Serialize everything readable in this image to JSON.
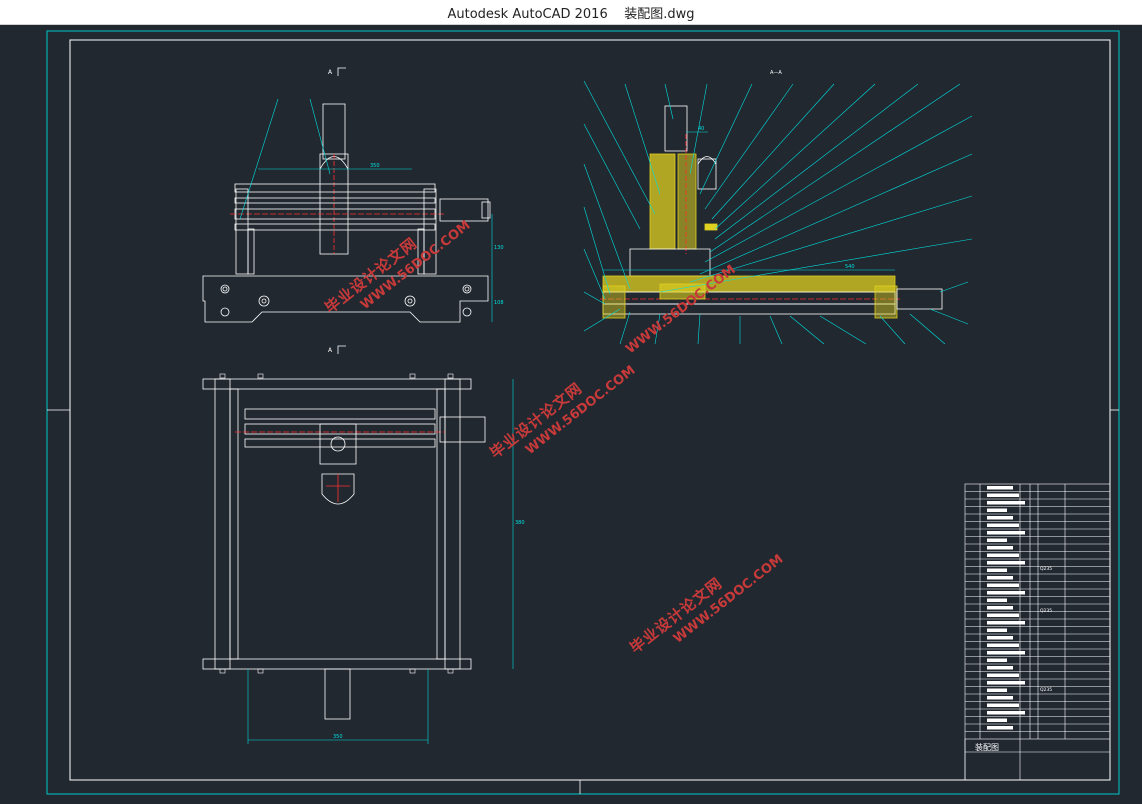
{
  "window": {
    "title": "Autodesk AutoCAD 2016    装配图.dwg"
  },
  "drawing": {
    "title_block_name": "装配图",
    "view_labels": {
      "top_view": "A",
      "section_view": "A—A"
    },
    "dimensions": {
      "top_width": "350",
      "front_width": "350",
      "front_height": "130",
      "front_height_2": "108",
      "section_width": "540",
      "section_small": "40",
      "plan_height": "380"
    },
    "materials": [
      "45钢",
      "Q235",
      "Q235",
      "Q235",
      "45钢"
    ]
  },
  "watermarks": [
    {
      "brand": "WWW.56DOC.COM",
      "cn": "毕业设计论文网"
    },
    {
      "brand": "WWW.56DOC.COM",
      "cn": "毕业设计论文网"
    },
    {
      "brand": "WWW.56DOC.COM",
      "cn": "毕业设计论文网"
    },
    {
      "brand": "WWW.56DOC.COM",
      "cn": "毕业设计论文网"
    }
  ],
  "colors": {
    "background": "#212830",
    "border": "#00c8c8",
    "line": "#ffffff",
    "accent": "#ff3030",
    "hatch": "#e0d020",
    "leader": "#00e0e0",
    "watermark": "#c83a3a"
  }
}
